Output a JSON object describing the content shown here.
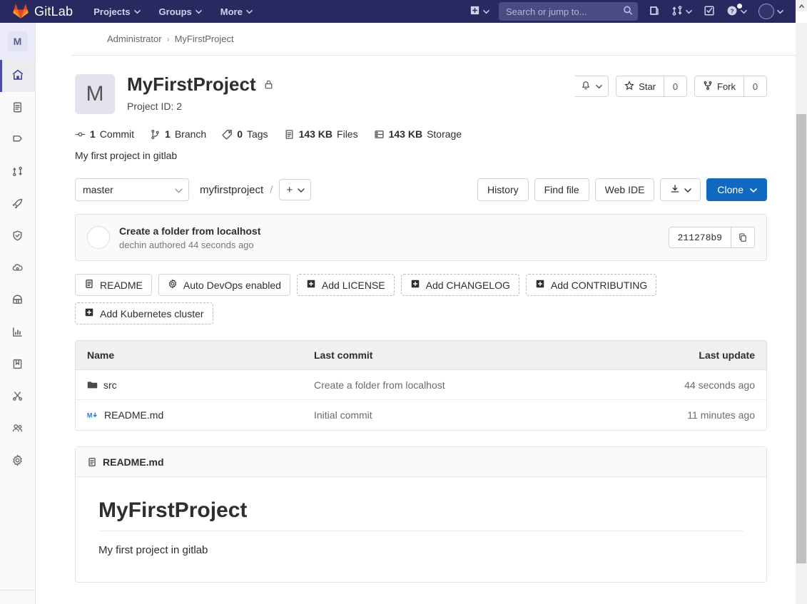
{
  "navbar": {
    "brand": "GitLab",
    "links": [
      {
        "label": "Projects",
        "name": "nav-projects"
      },
      {
        "label": "Groups",
        "name": "nav-groups"
      },
      {
        "label": "More",
        "name": "nav-more"
      }
    ],
    "search": {
      "placeholder": "Search or jump to...",
      "value": ""
    },
    "icons": {
      "create_new": "plus-square-icon",
      "search": "search-icon",
      "issues": "issues-icon",
      "merge_requests": "merge-request-icon",
      "todos": "todo-checkbox-icon",
      "help": "help-question-icon",
      "user": "user-avatar-icon"
    }
  },
  "sidebar": {
    "avatar_letter": "M",
    "items": [
      {
        "label": "Project overview",
        "icon": "home-icon",
        "active": true
      },
      {
        "label": "Repository",
        "icon": "document-icon",
        "active": false
      },
      {
        "label": "Issues",
        "icon": "issues-icon",
        "active": false
      },
      {
        "label": "Merge Requests",
        "icon": "merge-request-icon",
        "active": false
      },
      {
        "label": "CI/CD",
        "icon": "rocket-icon",
        "active": false
      },
      {
        "label": "Security & Compliance",
        "icon": "shield-icon",
        "active": false
      },
      {
        "label": "Operations",
        "icon": "cloud-gear-icon",
        "active": false
      },
      {
        "label": "Packages",
        "icon": "package-icon",
        "active": false
      },
      {
        "label": "Analytics",
        "icon": "chart-bar-icon",
        "active": false
      },
      {
        "label": "Wiki",
        "icon": "book-icon",
        "active": false
      },
      {
        "label": "Snippets",
        "icon": "scissors-icon",
        "active": false
      },
      {
        "label": "Members",
        "icon": "users-icon",
        "active": false
      },
      {
        "label": "Settings",
        "icon": "gear-icon",
        "active": false
      }
    ]
  },
  "breadcrumb": {
    "owner": "Administrator",
    "separator": "›",
    "project": "MyFirstProject"
  },
  "project": {
    "avatar_letter": "M",
    "title": "MyFirstProject",
    "visibility_icon": "lock-icon",
    "id_label": "Project ID: 2",
    "description": "My first project in gitlab",
    "stats": [
      {
        "icon": "commit-icon",
        "value": "1",
        "label": "Commit"
      },
      {
        "icon": "branch-icon",
        "value": "1",
        "label": "Branch"
      },
      {
        "icon": "tag-icon",
        "value": "0",
        "label": "Tags"
      },
      {
        "icon": "file-icon",
        "value": "143 KB",
        "label": "Files"
      },
      {
        "icon": "storage-icon",
        "value": "143 KB",
        "label": "Storage"
      }
    ],
    "actions": {
      "notification_icon": "bell-icon",
      "star_label": "Star",
      "star_count": "0",
      "fork_label": "Fork",
      "fork_count": "0"
    }
  },
  "repo_bar": {
    "branch": "master",
    "path_root": "myfirstproject",
    "path_separator": "/",
    "add_label": "+",
    "history_label": "History",
    "find_file_label": "Find file",
    "web_ide_label": "Web IDE",
    "download_icon": "download-icon",
    "clone_label": "Clone"
  },
  "last_commit": {
    "title": "Create a folder from localhost",
    "author": "dechin",
    "meta_suffix": "authored 44 seconds ago",
    "meta": "dechin authored 44 seconds ago",
    "sha": "211278b9",
    "copy_icon": "copy-clipboard-icon"
  },
  "badges": [
    {
      "label": "README",
      "icon": "document-icon",
      "dashed": false
    },
    {
      "label": "Auto DevOps enabled",
      "icon": "gear-icon",
      "dashed": false
    },
    {
      "label": "Add LICENSE",
      "icon": "plus-square-icon",
      "dashed": true
    },
    {
      "label": "Add CHANGELOG",
      "icon": "plus-square-icon",
      "dashed": true
    },
    {
      "label": "Add CONTRIBUTING",
      "icon": "plus-square-icon",
      "dashed": true
    },
    {
      "label": "Add Kubernetes cluster",
      "icon": "plus-square-icon",
      "dashed": true
    }
  ],
  "file_table": {
    "headers": {
      "name": "Name",
      "commit": "Last commit",
      "update": "Last update"
    },
    "rows": [
      {
        "icon": "folder-icon",
        "name": "src",
        "commit": "Create a folder from localhost",
        "update": "44 seconds ago"
      },
      {
        "icon": "markdown-icon",
        "name": "README.md",
        "commit": "Initial commit",
        "update": "11 minutes ago"
      }
    ]
  },
  "readme": {
    "filename": "README.md",
    "file_icon": "document-icon",
    "heading": "MyFirstProject",
    "body": "My first project in gitlab"
  },
  "colors": {
    "navbar_bg": "#292961",
    "primary_button": "#1068bf",
    "sidebar_active": "#4b4ba3",
    "markdown_icon": "#1f78d1"
  }
}
